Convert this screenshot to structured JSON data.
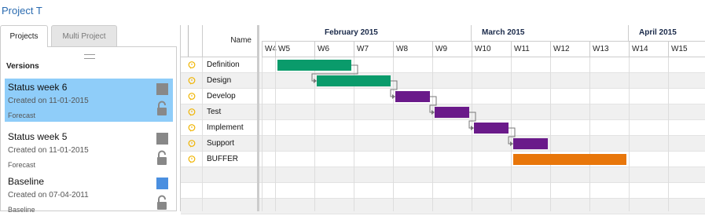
{
  "project": {
    "title": "Project T"
  },
  "tabs": [
    {
      "label": "Projects",
      "active": true
    },
    {
      "label": "Multi Project",
      "active": false
    }
  ],
  "versions": {
    "header": "Versions",
    "items": [
      {
        "name": "Status week 6",
        "created": "Created on 11-01-2015",
        "type": "Forecast",
        "selected": true,
        "color": "#888888",
        "lock_icon": "lock-open-icon"
      },
      {
        "name": "Status week 5",
        "created": "Created on 11-01-2015",
        "type": "Forecast",
        "selected": false,
        "color": "#888888",
        "lock_icon": "lock-open-icon"
      },
      {
        "name": "Baseline",
        "created": "Created on 07-04-2011",
        "type": "Baseline",
        "selected": false,
        "color": "#4a8fe0",
        "lock_icon": "lock-open-icon"
      }
    ]
  },
  "grid": {
    "name_header": "Name"
  },
  "timeline": {
    "months": [
      "February 2015",
      "March 2015",
      "April 2015"
    ],
    "weeks": [
      "W4",
      "W5",
      "W6",
      "W7",
      "W8",
      "W9",
      "W10",
      "W11",
      "W12",
      "W13",
      "W14",
      "W15"
    ]
  },
  "tasks": [
    {
      "name": "Definition",
      "start_week": "W5",
      "end_week": "W6",
      "color": "#0a9b6b"
    },
    {
      "name": "Design",
      "start_week": "W6",
      "end_week": "W7",
      "color": "#0a9b6b"
    },
    {
      "name": "Develop",
      "start_week": "W8",
      "end_week": "W8",
      "color": "#6a1a8a"
    },
    {
      "name": "Test",
      "start_week": "W9",
      "end_week": "W9",
      "color": "#6a1a8a"
    },
    {
      "name": "Implement",
      "start_week": "W10",
      "end_week": "W10",
      "color": "#6a1a8a"
    },
    {
      "name": "Support",
      "start_week": "W11",
      "end_week": "W11",
      "color": "#6a1a8a"
    },
    {
      "name": "BUFFER",
      "start_week": "W11",
      "end_week": "W13",
      "color": "#e8760a"
    }
  ],
  "colors": {
    "accent": "#2a6bb0",
    "selection": "#8fcdf9",
    "comment_icon": "#f0b400"
  }
}
